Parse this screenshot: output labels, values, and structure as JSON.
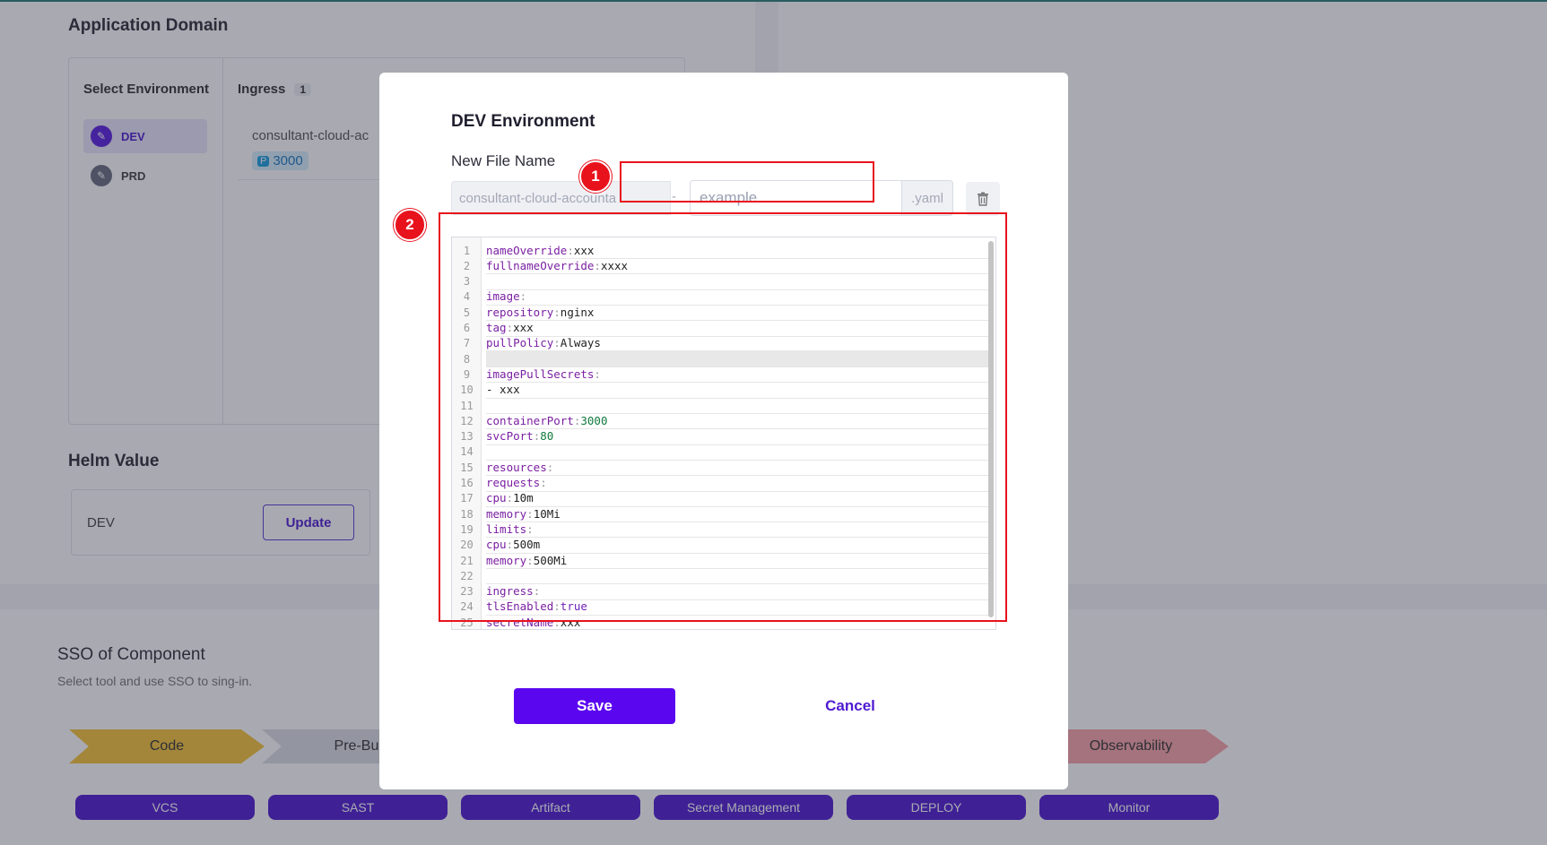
{
  "background": {
    "application_domain_title": "Application Domain",
    "select_environment_label": "Select Environment",
    "environments": [
      {
        "label": "DEV",
        "active": true
      },
      {
        "label": "PRD",
        "active": false
      }
    ],
    "ingress": {
      "label": "Ingress",
      "count": "1",
      "host": "consultant-cloud-ac",
      "port_prefix": "P",
      "port": "3000"
    },
    "helm_value": {
      "title": "Helm Value",
      "env": "DEV",
      "update_label": "Update"
    },
    "sso": {
      "title": "SSO of Component",
      "subtitle": "Select tool and use SSO to sing-in.",
      "stages": [
        {
          "label": "Code",
          "color": "#f5c43a"
        },
        {
          "label": "Pre-Buil",
          "color": "#dadce3"
        },
        {
          "label": "Observability",
          "color": "#f8a3a8"
        }
      ],
      "tools": [
        "VCS",
        "SAST",
        "Artifact",
        "Secret Management",
        "DEPLOY",
        "Monitor"
      ]
    }
  },
  "modal": {
    "title": "DEV Environment",
    "file_name_label": "New File Name",
    "prefix_value": "consultant-cloud-accounta",
    "separator": "-",
    "name_placeholder": "example",
    "name_value": "",
    "suffix": ".yaml",
    "delete_icon": "trash-icon",
    "markers": [
      "1",
      "2"
    ],
    "highlight_color": "#e8121d",
    "editor_lines": [
      {
        "n": "1",
        "indent": "",
        "key": "nameOverride",
        "value": "xxx",
        "type": "val"
      },
      {
        "n": "2",
        "indent": "",
        "key": "fullnameOverride",
        "value": "xxxx",
        "type": "val"
      },
      {
        "n": "3",
        "indent": "",
        "key": "",
        "value": "",
        "type": "blank"
      },
      {
        "n": "4",
        "indent": "",
        "key": "image",
        "value": "",
        "type": "val"
      },
      {
        "n": "5",
        "indent": "  ",
        "key": "repository",
        "value": "nginx",
        "type": "val"
      },
      {
        "n": "6",
        "indent": "  ",
        "key": "tag",
        "value": "xxx",
        "type": "val"
      },
      {
        "n": "7",
        "indent": "  ",
        "key": "pullPolicy",
        "value": "Always",
        "type": "val"
      },
      {
        "n": "8",
        "indent": "",
        "key": "",
        "value": "",
        "type": "blank",
        "active": true
      },
      {
        "n": "9",
        "indent": "",
        "key": "imagePullSecrets",
        "value": "",
        "type": "val"
      },
      {
        "n": "10",
        "indent": "  ",
        "key": "",
        "value": "- xxx",
        "type": "list"
      },
      {
        "n": "11",
        "indent": "",
        "key": "",
        "value": "",
        "type": "blank"
      },
      {
        "n": "12",
        "indent": "",
        "key": "containerPort",
        "value": "3000",
        "type": "num"
      },
      {
        "n": "13",
        "indent": "",
        "key": "svcPort",
        "value": "80",
        "type": "num"
      },
      {
        "n": "14",
        "indent": "",
        "key": "",
        "value": "",
        "type": "blank"
      },
      {
        "n": "15",
        "indent": "",
        "key": "resources",
        "value": "",
        "type": "val"
      },
      {
        "n": "16",
        "indent": "  ",
        "key": "requests",
        "value": "",
        "type": "val"
      },
      {
        "n": "17",
        "indent": "    ",
        "key": "cpu",
        "value": "10m",
        "type": "val"
      },
      {
        "n": "18",
        "indent": "    ",
        "key": "memory",
        "value": "10Mi",
        "type": "val"
      },
      {
        "n": "19",
        "indent": "  ",
        "key": "limits",
        "value": "",
        "type": "val"
      },
      {
        "n": "20",
        "indent": "    ",
        "key": "cpu",
        "value": "500m",
        "type": "val"
      },
      {
        "n": "21",
        "indent": "    ",
        "key": "memory",
        "value": "500Mi",
        "type": "val"
      },
      {
        "n": "22",
        "indent": "",
        "key": "",
        "value": "",
        "type": "blank"
      },
      {
        "n": "23",
        "indent": "",
        "key": "ingress",
        "value": "",
        "type": "val"
      },
      {
        "n": "24",
        "indent": "  ",
        "key": "tlsEnabled",
        "value": "true",
        "type": "bool"
      },
      {
        "n": "25",
        "indent": "  ",
        "key": "secretName",
        "value": "xxx",
        "type": "val"
      }
    ],
    "save_label": "Save",
    "cancel_label": "Cancel"
  }
}
